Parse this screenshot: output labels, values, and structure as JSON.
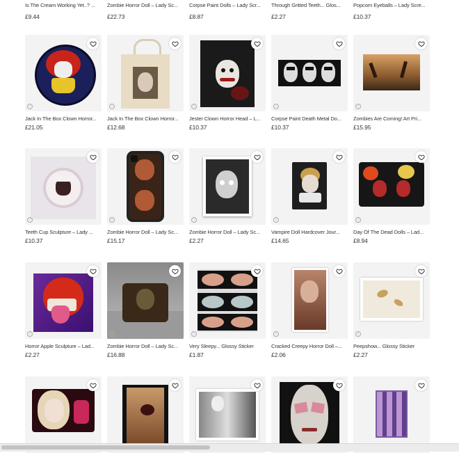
{
  "top_row": [
    {
      "title": "Is The Cream Working Yet..? ...",
      "price": "£9.44"
    },
    {
      "title": "Zombie Horror Doll – Lady Sc...",
      "price": "£22.73"
    },
    {
      "title": "Corpse Paint Dolls – Lady Scr...",
      "price": "£8.87"
    },
    {
      "title": "Through Gritted Teeth... Glos...",
      "price": "£2.27"
    },
    {
      "title": "Popcorn Eyeballs – Lady Scre...",
      "price": "£10.37"
    }
  ],
  "rows": [
    [
      {
        "title": "Jack In The Box Clown Horror...",
        "price": "£21.05",
        "art": "clock-art"
      },
      {
        "title": "Jack In The Box Clown Horror...",
        "price": "£12.68",
        "art": "tote-art"
      },
      {
        "title": "Jester Clown Horror Head – L...",
        "price": "£10.37",
        "art": "jester-art"
      },
      {
        "title": "Corpse Paint Death Metal Do...",
        "price": "£10.37",
        "art": "corpse-art"
      },
      {
        "title": "Zombies Are Coming! Art Pri...",
        "price": "£15.95",
        "art": "zombie-art"
      }
    ],
    [
      {
        "title": "Teeth Cup Sculpture – Lady ...",
        "price": "£10.37",
        "art": "cup-art"
      },
      {
        "title": "Zombie Horror Doll – Lady Sc...",
        "price": "£15.17",
        "art": "phone-art"
      },
      {
        "title": "Zombie Horror Doll – Lady Sc...",
        "price": "£2.27",
        "art": "doll-art"
      },
      {
        "title": "Vampire Doll Hardcover Jour...",
        "price": "£14.65",
        "art": "journal-art"
      },
      {
        "title": "Day Of The Dead Dolls – Lad...",
        "price": "£8.94",
        "art": "pouch-art"
      }
    ],
    [
      {
        "title": "Horror Apple Sculpture – Lad...",
        "price": "£2.27",
        "art": "apple-art"
      },
      {
        "title": "Zombie Horror Doll – Lady Sc...",
        "price": "£16.88",
        "art": "pillow-art"
      },
      {
        "title": "Very Sleepy... Glossy Sticker",
        "price": "£1.87",
        "art": "eyes-art"
      },
      {
        "title": "Cracked Creepy Horror Doll –...",
        "price": "£2.06",
        "art": "cracked-art"
      },
      {
        "title": "Peepshow... Glossy Sticker",
        "price": "£2.27",
        "art": "peep-art"
      }
    ],
    [
      {
        "title": "",
        "price": "",
        "art": "blonde-art"
      },
      {
        "title": "",
        "price": "",
        "art": "mouth-art"
      },
      {
        "title": "",
        "price": "",
        "art": "bw-art"
      },
      {
        "title": "",
        "price": "",
        "art": "face-art"
      },
      {
        "title": "",
        "price": "",
        "art": "grid-art"
      }
    ]
  ],
  "icons": {
    "favorite": "heart-icon",
    "info": "info-icon"
  },
  "colors": {
    "page_bg": "#ffffff",
    "tile_bg": "#f3f3f3",
    "text": "#333333"
  }
}
